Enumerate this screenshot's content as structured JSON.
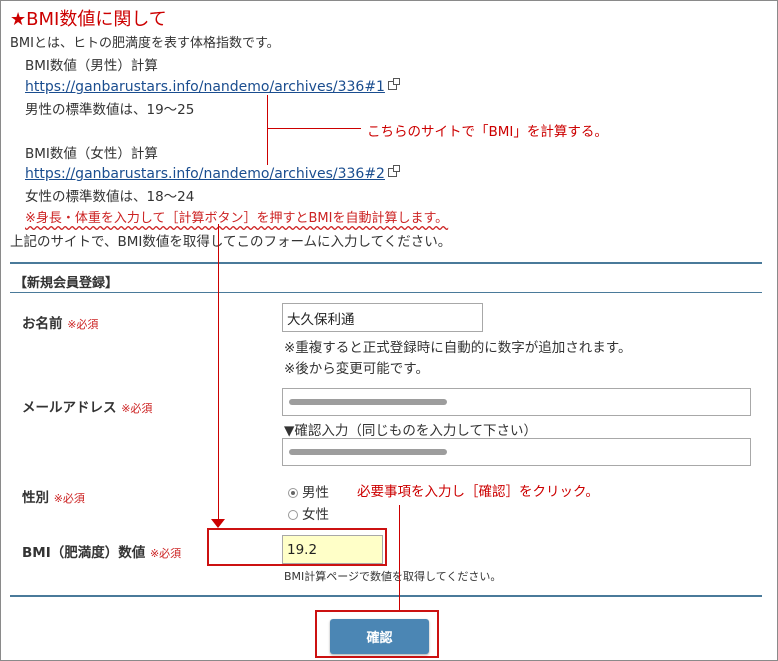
{
  "header": {
    "title": "★BMI数値に関して",
    "intro": "BMIとは、ヒトの肥満度を表す体格指数です。"
  },
  "bmi_info": {
    "male_label": "BMI数値（男性）計算",
    "male_link": "https://ganbarustars.info/nandemo/archives/336#1",
    "male_std": "男性の標準数値は、19～25",
    "female_label": "BMI数値（女性）計算",
    "female_link": "https://ganbarustars.info/nandemo/archives/336#2",
    "female_std": "女性の標準数値は、18～24",
    "note": "※身長・体重を入力して［計算ボタン］を押すとBMIを自動計算します。",
    "instruction": "上記のサイトで、BMI数値を取得してこのフォームに入力してください。"
  },
  "annotations": {
    "site_calc": "こちらのサイトで「BMI」を計算する。",
    "click_confirm": "必要事項を入力し［確認］をクリック。"
  },
  "form": {
    "section_title": "【新規会員登録】",
    "required_mark": "※必須",
    "name": {
      "label": "お名前",
      "value": "大久保利通",
      "note1": "※重複すると正式登録時に自動的に数字が追加されます。",
      "note2": "※後から変更可能です。"
    },
    "email": {
      "label": "メールアドレス",
      "confirm_label": "▼確認入力（同じものを入力して下さい）"
    },
    "gender": {
      "label": "性別",
      "options": [
        "男性",
        "女性"
      ],
      "selected": "男性"
    },
    "bmi": {
      "label": "BMI（肥満度）数値",
      "value": "19.2",
      "note": "BMI計算ページで数値を取得してください。"
    },
    "submit_label": "確認"
  },
  "colors": {
    "accent_red": "#cc0000",
    "link_blue": "#1a4d8f",
    "button_blue": "#4b86b4",
    "separator": "#4a7a9a",
    "highlight_input": "#ffffc8"
  }
}
